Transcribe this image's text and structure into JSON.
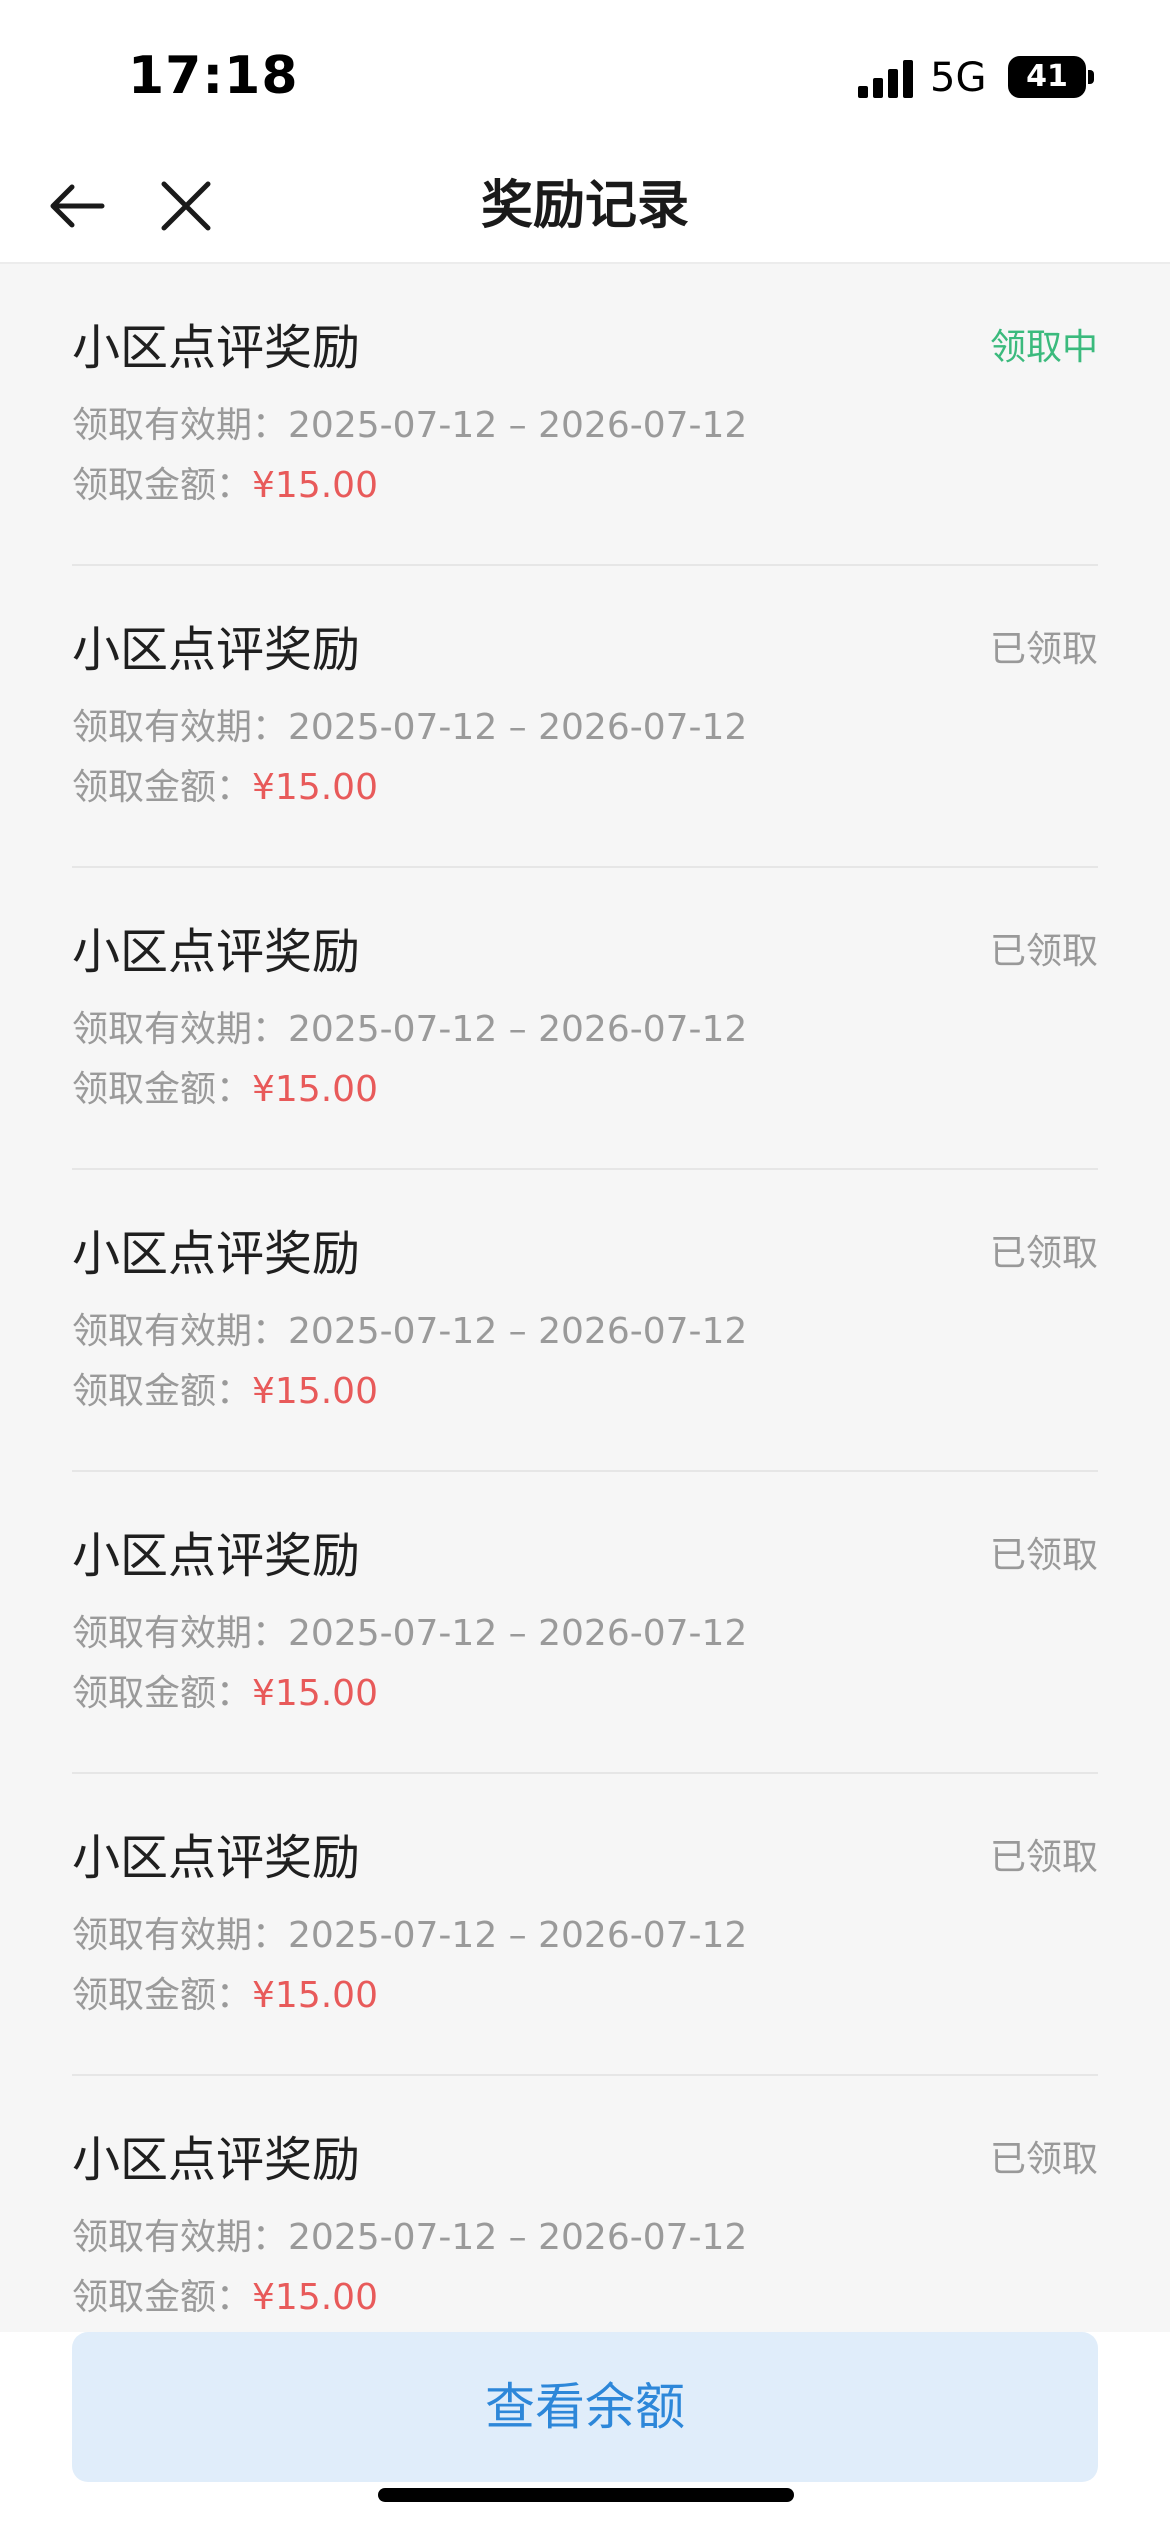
{
  "status_bar": {
    "time": "17:18",
    "network": "5G",
    "battery": "41",
    "icons": [
      "signal-icon",
      "battery-icon"
    ]
  },
  "nav": {
    "title": "奖励记录",
    "icons": [
      "back-arrow-icon",
      "close-icon"
    ]
  },
  "records": [
    {
      "title": "小区点评奖励",
      "status": "领取中",
      "validity_label": "领取有效期：",
      "validity": "2025-07-12 – 2026-07-12",
      "amount_label": "领取金额：",
      "amount": "¥15.00"
    },
    {
      "title": "小区点评奖励",
      "status": "已领取",
      "validity_label": "领取有效期：",
      "validity": "2025-07-12 – 2026-07-12",
      "amount_label": "领取金额：",
      "amount": "¥15.00"
    },
    {
      "title": "小区点评奖励",
      "status": "已领取",
      "validity_label": "领取有效期：",
      "validity": "2025-07-12 – 2026-07-12",
      "amount_label": "领取金额：",
      "amount": "¥15.00"
    },
    {
      "title": "小区点评奖励",
      "status": "已领取",
      "validity_label": "领取有效期：",
      "validity": "2025-07-12 – 2026-07-12",
      "amount_label": "领取金额：",
      "amount": "¥15.00"
    },
    {
      "title": "小区点评奖励",
      "status": "已领取",
      "validity_label": "领取有效期：",
      "validity": "2025-07-12 – 2026-07-12",
      "amount_label": "领取金额：",
      "amount": "¥15.00"
    },
    {
      "title": "小区点评奖励",
      "status": "已领取",
      "validity_label": "领取有效期：",
      "validity": "2025-07-12 – 2026-07-12",
      "amount_label": "领取金额：",
      "amount": "¥15.00"
    },
    {
      "title": "小区点评奖励",
      "status": "已领取",
      "validity_label": "领取有效期：",
      "validity": "2025-07-12 – 2026-07-12",
      "amount_label": "领取金额：",
      "amount": "¥15.00"
    }
  ],
  "bottom": {
    "balance_button_label": "查看余额"
  },
  "colors": {
    "claiming_status": "#3bba7d",
    "claimed_status": "#999999",
    "amount": "#e85a5a",
    "button_bg": "#e0edfa",
    "button_text": "#2d87d9"
  }
}
